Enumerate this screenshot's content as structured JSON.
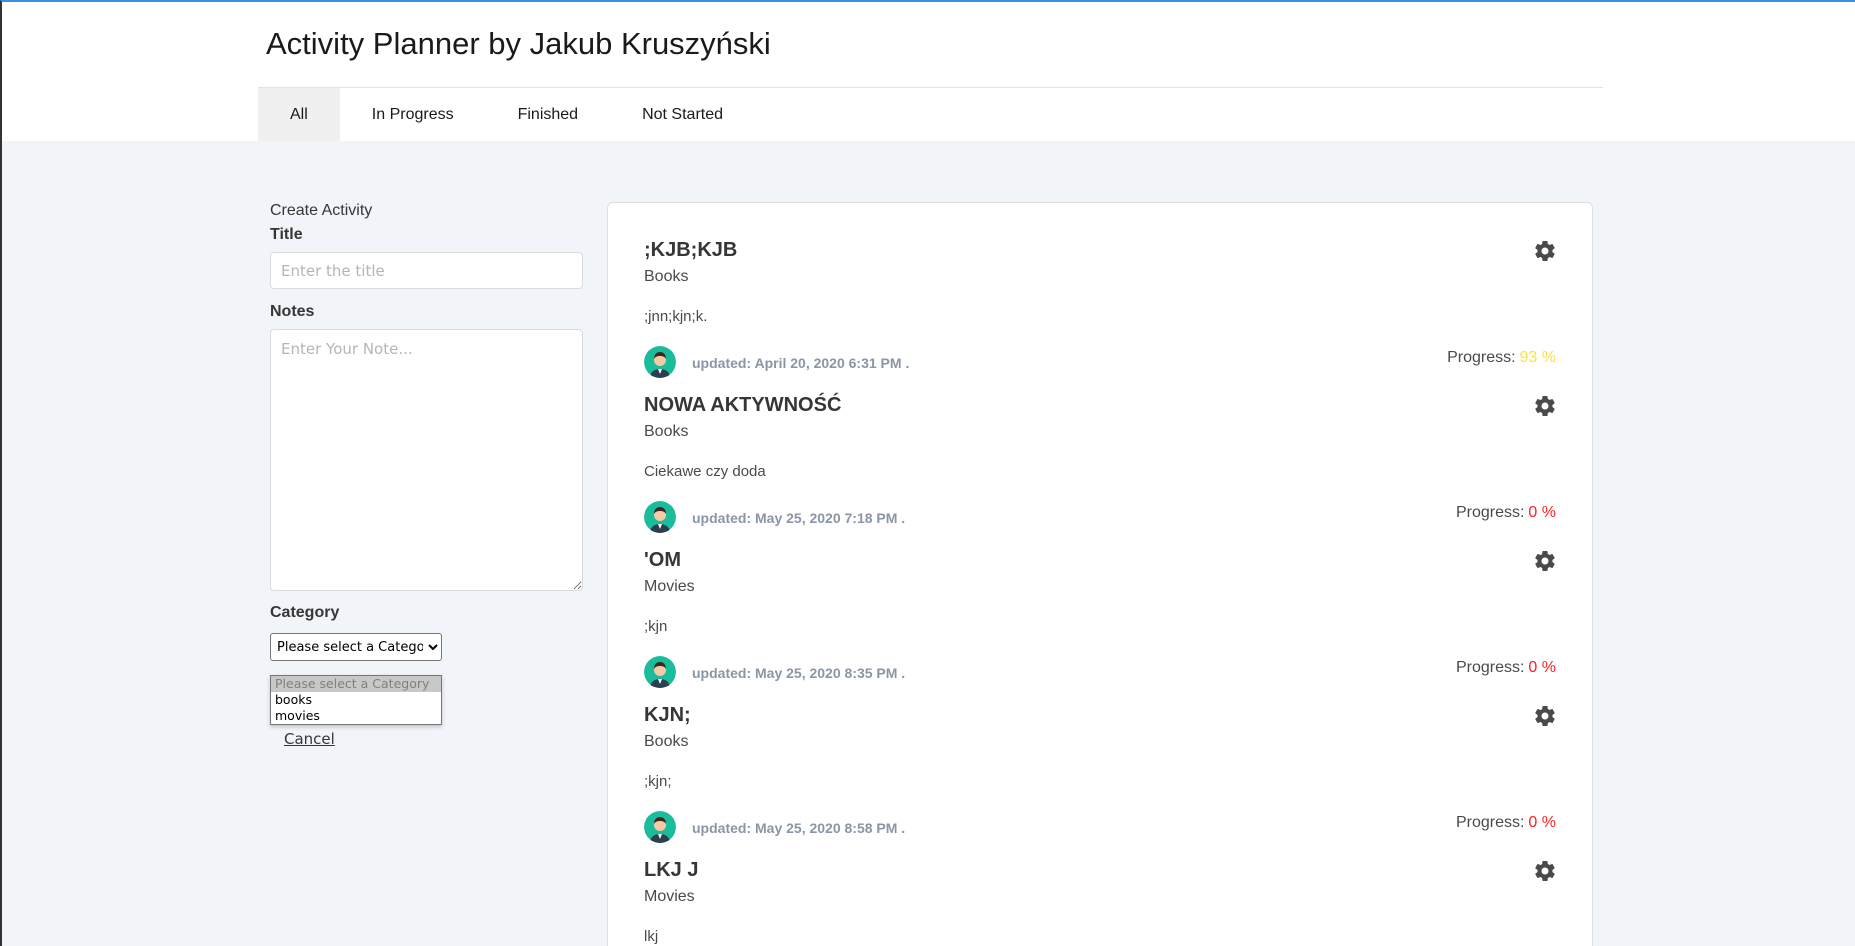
{
  "app": {
    "title": "Activity Planner by Jakub Kruszyński"
  },
  "tabs": [
    {
      "label": "All",
      "active": true
    },
    {
      "label": "In Progress",
      "active": false
    },
    {
      "label": "Finished",
      "active": false
    },
    {
      "label": "Not Started",
      "active": false
    }
  ],
  "form": {
    "heading": "Create Activity",
    "title_label": "Title",
    "title_placeholder": "Enter the title",
    "title_value": "",
    "notes_label": "Notes",
    "notes_placeholder": "Enter Your Note...",
    "notes_value": "",
    "category_label": "Category",
    "category_selected": "Please select a Category",
    "category_options": [
      "Please select a Category",
      "books",
      "movies"
    ],
    "cancel_label": "Cancel"
  },
  "activities": [
    {
      "title": ";KJB;KJB",
      "category": "Books",
      "notes": ";jnn;kjn;k.",
      "updated": "updated: April 20, 2020 6:31 PM .",
      "progress_label": "Progress:",
      "progress": "93 %",
      "progress_color": "#ffe03a"
    },
    {
      "title": "NOWA AKTYWNOŚĆ",
      "category": "Books",
      "notes": "Ciekawe czy doda",
      "updated": "updated: May 25, 2020 7:18 PM .",
      "progress_label": "Progress:",
      "progress": "0 %",
      "progress_color": "#ff2020"
    },
    {
      "title": "'OM",
      "category": "Movies",
      "notes": ";kjn",
      "updated": "updated: May 25, 2020 8:35 PM .",
      "progress_label": "Progress:",
      "progress": "0 %",
      "progress_color": "#ff2020"
    },
    {
      "title": "KJN;",
      "category": "Books",
      "notes": ";kjn;",
      "updated": "updated: May 25, 2020 8:58 PM .",
      "progress_label": "Progress:",
      "progress": "0 %",
      "progress_color": "#ff2020"
    },
    {
      "title": "LKJ J",
      "category": "Movies",
      "notes": "lkj",
      "updated": "",
      "progress_label": "",
      "progress": "",
      "progress_color": "#ff2020"
    }
  ],
  "icons": {
    "gear": "gear-icon",
    "avatar": "avatar-icon"
  },
  "colors": {
    "accent_top_border": "#3b8ee8",
    "avatar_bg": "#1abc9c",
    "meta_text": "#8a95a5"
  }
}
